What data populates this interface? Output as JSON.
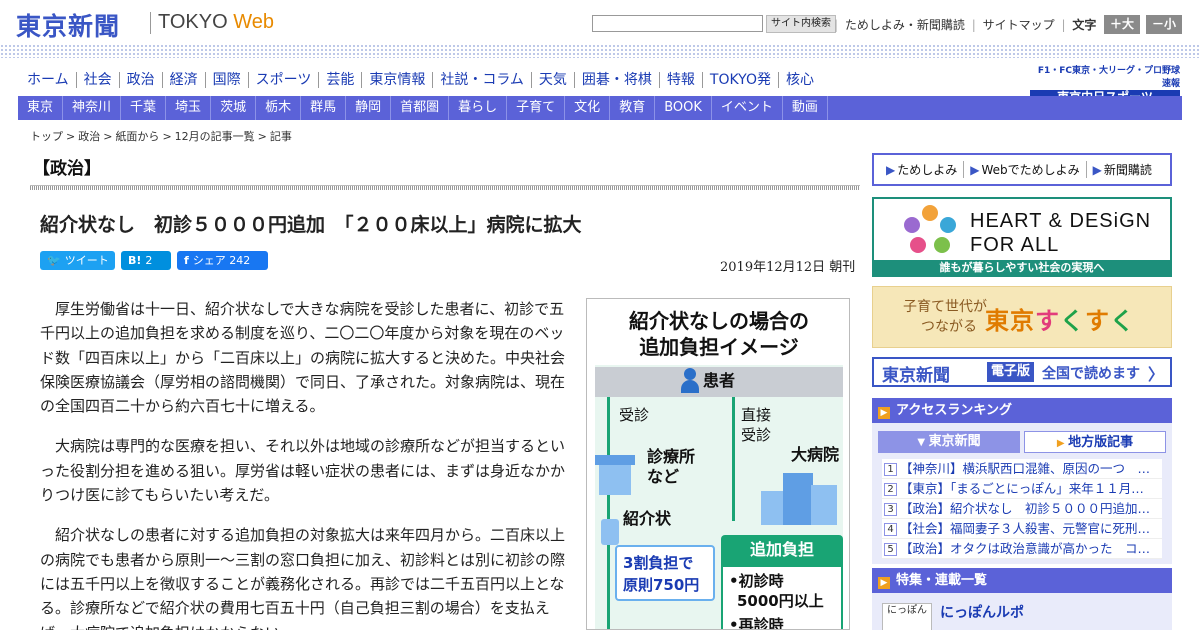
{
  "header": {
    "logo_ja": "東京新聞",
    "logo_en_main": "TOKYO ",
    "logo_en_web": "Web",
    "search_button": "サイト内検索",
    "top_links": [
      "ためしよみ・新聞購読",
      "サイトマップ"
    ],
    "font_size_label": "文字（0）",
    "font_larger": "＋大",
    "font_smaller": "－小"
  },
  "genre_nav": [
    "ホーム",
    "社会",
    "政治",
    "経済",
    "国際",
    "スポーツ",
    "芸能",
    "東京情報",
    "社説・コラム",
    "天気",
    "囲碁・将棋",
    "特報",
    "TOKYO発",
    "核心"
  ],
  "chunichi": {
    "line1": "F1・FC東京・大リーグ・プロ野球速報",
    "line2": "東京中日スポーツ"
  },
  "region_nav": [
    "東京",
    "神奈川",
    "千葉",
    "埼玉",
    "茨城",
    "栃木",
    "群馬",
    "静岡",
    "首都圏",
    "暮らし",
    "子育て",
    "文化",
    "教育",
    "BOOK",
    "イベント",
    "動画"
  ],
  "breadcrumb": [
    "トップ",
    "政治",
    "紙面から",
    "12月の記事一覧",
    "記事"
  ],
  "section_title": "【政治】",
  "headline": "紹介状なし　初診５０００円追加　「２００床以上」病院に拡大",
  "share": {
    "tweet": "ツイート",
    "hatena_count": "2",
    "facebook": "シェア",
    "facebook_count": "242"
  },
  "dateline": "2019年12月12日 朝刊",
  "article": [
    "厚生労働省は十一日、紹介状なしで大きな病院を受診した患者に、初診で五千円以上の追加負担を求める制度を巡り、二〇二〇年度から対象を現在のベッド数「四百床以上」から「二百床以上」の病院に拡大すると決めた。中央社会保険医療協議会（厚労相の諮問機関）で同日、了承された。対象病院は、現在の全国四百二十から約六百七十に増える。",
    "大病院は専門的な医療を担い、それ以外は地域の診療所などが担当するといった役割分担を進める狙い。厚労省は軽い症状の患者には、まずは身近なかかりつけ医に診てもらいたい考えだ。",
    "紹介状なしの患者に対する追加負担の対象拡大は来年四月から。二百床以上の病院でも患者から原則一～三割の窓口負担に加え、初診料とは別に初診の際には五千円以上を徴収することが義務化される。再診では二千五百円以上となる。診療所などで紹介状の費用七百五十円（自己負担三割の場合）を支払えば、大病院で追加負担はかからない。"
  ],
  "figure": {
    "title_line1": "紹介状なしの場合の",
    "title_line2": "追加負担イメージ",
    "patient": "患者",
    "left_route": "受診",
    "right_route_1": "直接",
    "right_route_2": "受診",
    "clinic_1": "診療所",
    "clinic_2": "など",
    "hospital": "大病院",
    "referral": "紹介状",
    "box1_line1": "3割負担で",
    "box1_line2": "原則750円",
    "box2_head": "追加負担",
    "box2_line1": "•初診時",
    "box2_line2": "5000円以上",
    "box2_line3": "•再診時"
  },
  "sidebar": {
    "links": [
      "ためしよみ",
      "Webでためしよみ",
      "新聞購読"
    ],
    "heart_main_1": "HEART & DESiGN",
    "heart_main_2": "FOR ALL",
    "heart_sub": "誰もが暮らしやすい社会の実現へ",
    "suku_line1": "子育て世代が",
    "suku_line2": "つながる",
    "suku_big_1": "東京",
    "suku_big_2": "す",
    "suku_big_3": "く",
    "suku_big_4": "す",
    "suku_big_5": "く",
    "epaper_logo": "東京新聞",
    "epaper_tag": "電子版",
    "epaper_read": "全国で読めます",
    "ranking_title": "アクセスランキング",
    "ranking_tabs": [
      "東京新聞",
      "地方版記事"
    ],
    "ranking_items": [
      "【神奈川】横浜駅西口混雑、原因の一つ　…",
      "【東京】「まるごとにっぽん」来年１１月…",
      "【政治】紹介状なし　初診５０００円追加…",
      "【社会】福岡妻子３人殺害、元警官に死刑…",
      "【政治】オタクは政治意識が高かった　コ…"
    ],
    "feature_title": "特集・連載一覧",
    "feature_thumb": "にっぽん",
    "feature_item": "にっぽんルポ"
  },
  "colors": {
    "brand_blue": "#3a56c5",
    "nav_purple": "#5b62d8",
    "accent_green": "#19a474"
  }
}
